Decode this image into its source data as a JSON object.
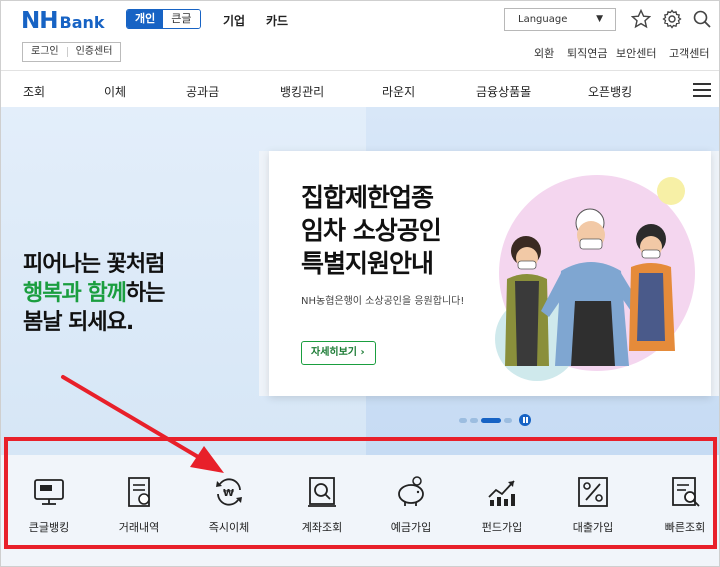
{
  "header": {
    "logo_nh": "NH",
    "logo_bank": "Bank",
    "segment": {
      "personal": "개인",
      "simple": "큰글"
    },
    "topnav": [
      "기업",
      "카드"
    ],
    "language": "Language",
    "login": "로그인",
    "cert": "인증센터",
    "util": [
      "외환",
      "퇴직연금",
      "보안센터",
      "고객센터"
    ]
  },
  "gnb": [
    "조회",
    "이체",
    "공과금",
    "뱅킹관리",
    "라운지",
    "금융상품몰",
    "오픈뱅킹"
  ],
  "hero": {
    "slogan_line1": "피어나는 꽃처럼",
    "slogan_green": "행복과 함께",
    "slogan_rest": "하는",
    "slogan_line3": "봄날 되세요.",
    "card_title_1": "집합제한업종",
    "card_title_2": "임차 소상공인",
    "card_title_3": "특별지원안내",
    "card_sub": "NH농협은행이 소상공인을 응원합니다!",
    "card_button": "자세히보기"
  },
  "quick_menu": [
    "큰글뱅킹",
    "거래내역",
    "즉시이체",
    "계좌조회",
    "예금가입",
    "펀드가입",
    "대출가입",
    "빠른조회"
  ],
  "colors": {
    "brand": "#1763c4",
    "green": "#1a9e3f",
    "annotation": "#e8202a"
  }
}
